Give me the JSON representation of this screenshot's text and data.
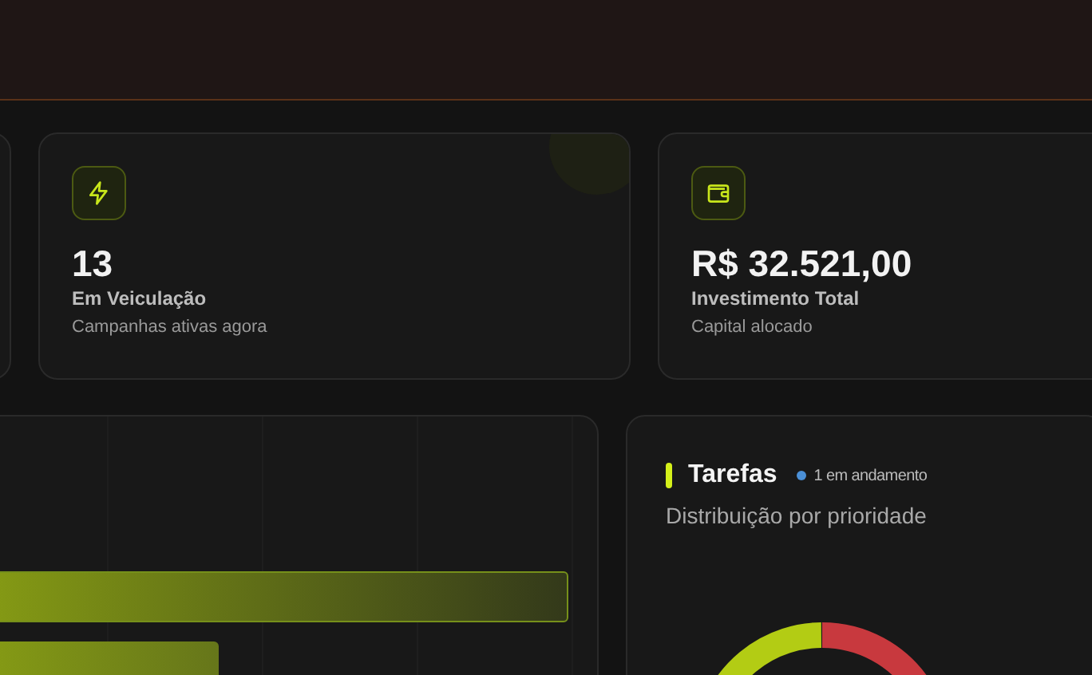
{
  "stat_cards": [
    {
      "kind": "bolt",
      "value": "13",
      "title": "Em Veiculação",
      "subtitle": "Campanhas ativas agora"
    },
    {
      "kind": "wallet",
      "value": "R$ 32.521,00",
      "title": "Investimento Total",
      "subtitle": "Capital alocado"
    }
  ],
  "tasks": {
    "title": "Tarefas",
    "status": {
      "text": "1 em andamento",
      "color": "#4a8fd6"
    },
    "subtitle": "Distribuição por prioridade"
  }
}
